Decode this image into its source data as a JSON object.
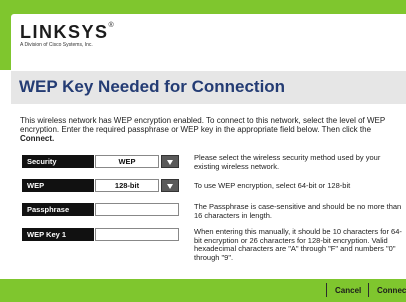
{
  "brand": {
    "logo": "LINKSYS",
    "registered": "®",
    "tagline": "A Division of Cisco Systems, Inc."
  },
  "page": {
    "title": "WEP Key Needed for Connection",
    "intro_pre": "This wireless network has WEP encryption enabled. To connect to this network, select the level of WEP encryption. Enter the required passphrase or WEP key in the appropriate field below. Then click the ",
    "intro_bold": "Connect."
  },
  "form": {
    "security": {
      "label": "Security",
      "value": "WEP",
      "description": "Please select the wireless security method used by your existing wireless network."
    },
    "wep": {
      "label": "WEP",
      "value": "128-bit",
      "description": "To use WEP encryption, select 64-bit or 128-bit"
    },
    "passphrase": {
      "label": "Passphrase",
      "value": "",
      "description": "The Passphrase is case-sensitive and should be no more than 16 characters in length."
    },
    "wep_key1": {
      "label": "WEP Key 1",
      "value": "",
      "description": "When entering this manually, it should be 10 characters for 64-bit encryption or 26 characters for 128-bit encryption. Valid hexadecimal characters are \"A\" through \"F\" and numbers \"0\" through \"9\"."
    }
  },
  "buttons": {
    "cancel": "Cancel",
    "connect": "Connect"
  },
  "colors": {
    "accent_green": "#7fc62e",
    "title_blue": "#243c74"
  }
}
